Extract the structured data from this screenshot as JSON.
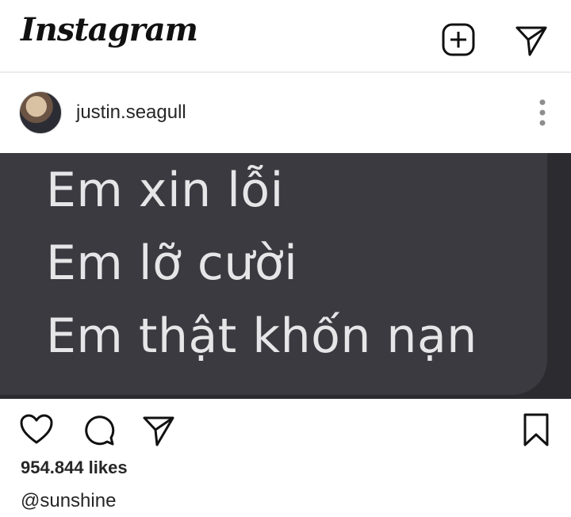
{
  "app": {
    "logo_text": "Instagram"
  },
  "header": {
    "icons": [
      "add-post-icon",
      "direct-message-icon"
    ]
  },
  "post": {
    "username": "justin.seagull",
    "image_text_lines": [
      "Em xin lỗi",
      "Em lỡ cười",
      "Em thật khốn nạn"
    ],
    "likes": "954.844 likes",
    "caption": "@sunshine"
  },
  "actions": {
    "icons": [
      "heart-icon",
      "comment-icon",
      "share-icon",
      "bookmark-icon"
    ]
  },
  "colors": {
    "text": "#262626",
    "image_background": "#2b2b30",
    "bubble": "#3a3a40",
    "bubble_text": "#e6e6e8"
  }
}
